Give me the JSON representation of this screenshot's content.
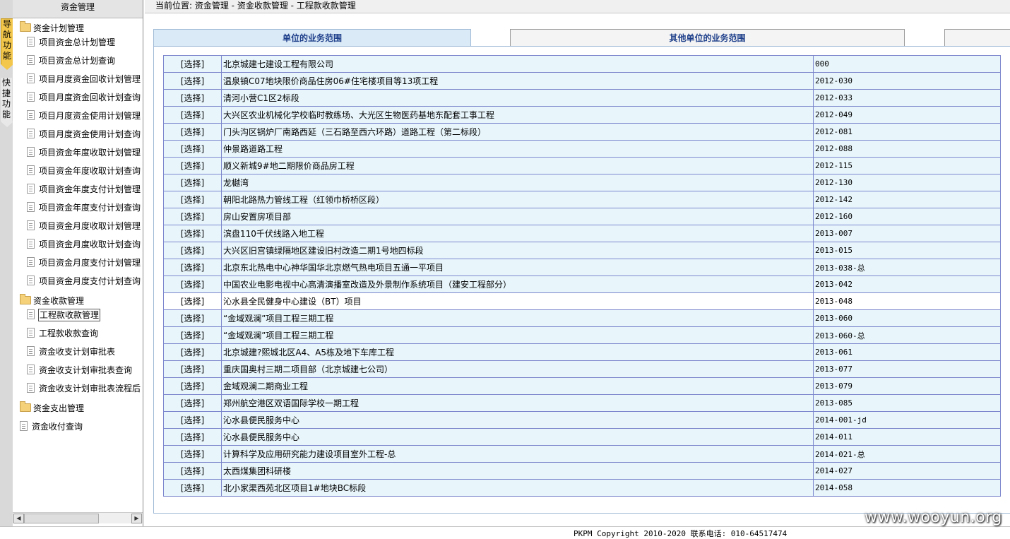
{
  "vtabs": {
    "nav": "导航功能",
    "quick": "快捷功能"
  },
  "sidebar": {
    "title": "资金管理",
    "plan_group": "资金计划管理",
    "plan_items": [
      "项目资金总计划管理",
      "项目资金总计划查询",
      "项目月度资金回收计划管理",
      "项目月度资金回收计划查询",
      "项目月度资金使用计划管理",
      "项目月度资金使用计划查询",
      "项目资金年度收取计划管理",
      "项目资金年度收取计划查询",
      "项目资金年度支付计划管理",
      "项目资金年度支付计划查询",
      "项目资金月度收取计划管理",
      "项目资金月度收取计划查询",
      "项目资金月度支付计划管理",
      "项目资金月度支付计划查询"
    ],
    "receipt_group": "资金收款管理",
    "receipt_items": [
      "工程款收款管理",
      "工程款收款查询",
      "资金收支计划审批表",
      "资金收支计划审批表查询",
      "资金收支计划审批表流程后"
    ],
    "expense_group": "资金支出管理",
    "query_item": "资金收付查询"
  },
  "breadcrumb": "当前位置: 资金管理 - 资金收款管理 - 工程款收款管理",
  "tabs": {
    "own": "单位的业务范围",
    "other": "其他单位的业务范围"
  },
  "table": {
    "select_label": "[选择]",
    "rows": [
      {
        "name": "北京城建七建设工程有限公司",
        "code": "000"
      },
      {
        "name": "温泉镇C07地块限价商品住房06#住宅楼项目等13项工程",
        "code": "2012-030"
      },
      {
        "name": "清河小营C1区2标段",
        "code": "2012-033"
      },
      {
        "name": "大兴区农业机械化学校临时教练场、大光区生物医药基地东配套工事工程",
        "code": "2012-049"
      },
      {
        "name": "门头沟区锅炉厂南路西延（三石路至西六环路）道路工程（第二标段）",
        "code": "2012-081"
      },
      {
        "name": "仲景路道路工程",
        "code": "2012-088"
      },
      {
        "name": "顺义新城9#地二期限价商品房工程",
        "code": "2012-115"
      },
      {
        "name": "龙樾湾",
        "code": "2012-130"
      },
      {
        "name": "朝阳北路热力管线工程（红领巾桥桥区段）",
        "code": "2012-142"
      },
      {
        "name": "房山安置房项目部",
        "code": "2012-160"
      },
      {
        "name": "滨盘110千伏线路入地工程",
        "code": "2013-007"
      },
      {
        "name": "大兴区旧宫镇绿隔地区建设旧村改造二期1号地四标段",
        "code": "2013-015"
      },
      {
        "name": "北京东北热电中心神华国华北京燃气热电项目五通一平项目",
        "code": "2013-038-总"
      },
      {
        "name": "中国农业电影电视中心高清演播室改造及外景制作系统项目（建安工程部分）",
        "code": "2013-042"
      },
      {
        "name": "沁水县全民健身中心建设（BT）项目",
        "code": "2013-048"
      },
      {
        "name": "“金域观澜”项目工程三期工程",
        "code": "2013-060"
      },
      {
        "name": "“金域观澜”项目工程三期工程",
        "code": "2013-060-总"
      },
      {
        "name": "北京城建?熙城北区A4、A5栋及地下车库工程",
        "code": "2013-061"
      },
      {
        "name": "重庆国奥村三期二项目部（北京城建七公司）",
        "code": "2013-077"
      },
      {
        "name": "金域观澜二期商业工程",
        "code": "2013-079"
      },
      {
        "name": "郑州航空港区双语国际学校一期工程",
        "code": "2013-085"
      },
      {
        "name": "沁水县便民服务中心",
        "code": "2014-001-jd"
      },
      {
        "name": "沁水县便民服务中心",
        "code": "2014-011"
      },
      {
        "name": "计算科学及应用研究能力建设项目室外工程-总",
        "code": "2014-021-总"
      },
      {
        "name": "太西煤集团科研楼",
        "code": "2014-027"
      },
      {
        "name": "北小家渠西苑北区项目1#地块BC标段",
        "code": "2014-058"
      }
    ],
    "highlighted_row": 14
  },
  "footer": "PKPM Copyright 2010-2020 联系电话: 010-64517474",
  "watermark": "www.wooyun.org",
  "colors": {
    "accent_tab": "#dbeaf7",
    "row_bg": "#e8f6fc",
    "border": "#7c86cc",
    "nav_tab": "#f2c74b"
  }
}
